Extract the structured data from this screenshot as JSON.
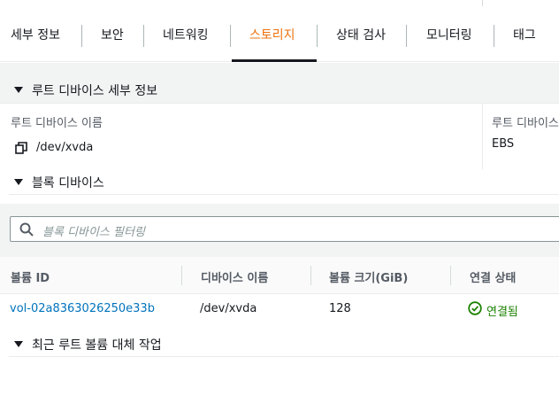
{
  "tabs": [
    {
      "label": "세부 정보",
      "active": false
    },
    {
      "label": "보안",
      "active": false
    },
    {
      "label": "네트워킹",
      "active": false
    },
    {
      "label": "스토리지",
      "active": true
    },
    {
      "label": "상태 검사",
      "active": false
    },
    {
      "label": "모니터링",
      "active": false
    },
    {
      "label": "태그",
      "active": false
    }
  ],
  "root_device": {
    "section_title": "루트 디바이스 세부 정보",
    "name_label": "루트 디바이스 이름",
    "name_value": "/dev/xvda",
    "type_label": "루트 디바이스",
    "type_value": "EBS",
    "copy_icon": "copy-icon"
  },
  "block_devices": {
    "section_title": "블록 디바이스",
    "search_placeholder": "블록 디바이스 필터링",
    "search_icon": "search-icon",
    "columns": [
      "볼륨 ID",
      "디바이스 이름",
      "볼륨 크기(GiB)",
      "연결 상태"
    ],
    "rows": [
      {
        "volume_id": "vol-02a8363026250e33b",
        "device_name": "/dev/xvda",
        "size": "128",
        "status": "연결됨"
      }
    ]
  },
  "replacement": {
    "section_title": "최근 루트 볼륨 대체 작업"
  },
  "colors": {
    "accent": "#ec7211",
    "link": "#0073bb",
    "success": "#1d8102"
  }
}
